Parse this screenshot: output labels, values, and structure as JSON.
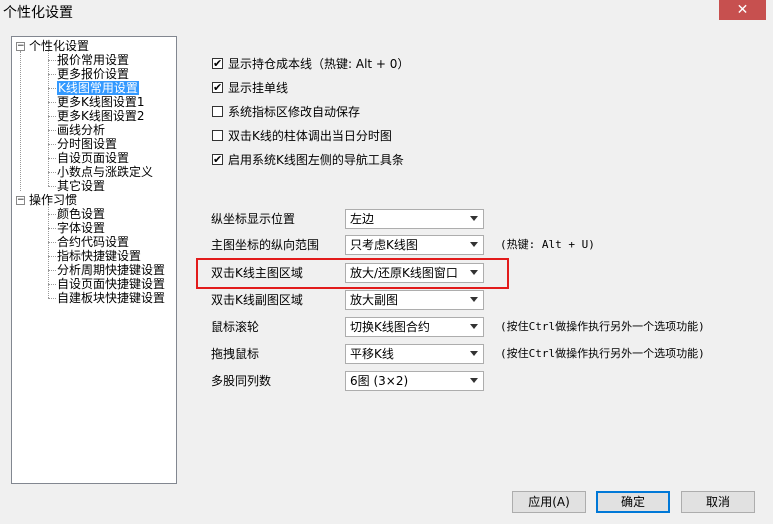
{
  "window": {
    "title": "个性化设置",
    "close_glyph": "✕"
  },
  "tree": {
    "groups": [
      {
        "label": "个性化设置",
        "expander": "−",
        "items": [
          "报价常用设置",
          "更多报价设置",
          "K线图常用设置",
          "更多K线图设置1",
          "更多K线图设置2",
          "画线分析",
          "分时图设置",
          "自设页面设置",
          "小数点与涨跌定义",
          "其它设置"
        ]
      },
      {
        "label": "操作习惯",
        "expander": "−",
        "items": [
          "颜色设置",
          "字体设置",
          "合约代码设置",
          "指标快捷键设置",
          "分析周期快捷键设置",
          "自设页面快捷键设置",
          "自建板块快捷键设置"
        ]
      }
    ],
    "selected": "K线图常用设置"
  },
  "checkboxes": [
    {
      "label": "显示持仓成本线（热键: Alt + 0）",
      "checked": true
    },
    {
      "label": "显示挂单线",
      "checked": true
    },
    {
      "label": "系统指标区修改自动保存",
      "checked": false
    },
    {
      "label": "双击K线的柱体调出当日分时图",
      "checked": false
    },
    {
      "label": "启用系统K线图左侧的导航工具条",
      "checked": true
    }
  ],
  "check_glyph": "✔",
  "fields": [
    {
      "label": "纵坐标显示位置",
      "value": "左边",
      "hint": ""
    },
    {
      "label": "主图坐标的纵向范围",
      "value": "只考虑K线图",
      "hint": "(热键: Alt + U)"
    },
    {
      "label": "双击K线主图区域",
      "value": "放大/还原K线图窗口",
      "hint": ""
    },
    {
      "label": "双击K线副图区域",
      "value": "放大副图",
      "hint": ""
    },
    {
      "label": "鼠标滚轮",
      "value": "切换K线图合约",
      "hint": "(按住Ctrl做操作执行另外一个选项功能)"
    },
    {
      "label": "拖拽鼠标",
      "value": "平移K线",
      "hint": "(按住Ctrl做操作执行另外一个选项功能)"
    },
    {
      "label": "多股同列数",
      "value": "6图 (3×2)",
      "hint": ""
    }
  ],
  "buttons": {
    "apply": "应用(A)",
    "ok": "确定",
    "cancel": "取消"
  },
  "colors": {
    "selection": "#3399ff",
    "highlight_border": "#e21b1b",
    "close": "#c7504f"
  }
}
